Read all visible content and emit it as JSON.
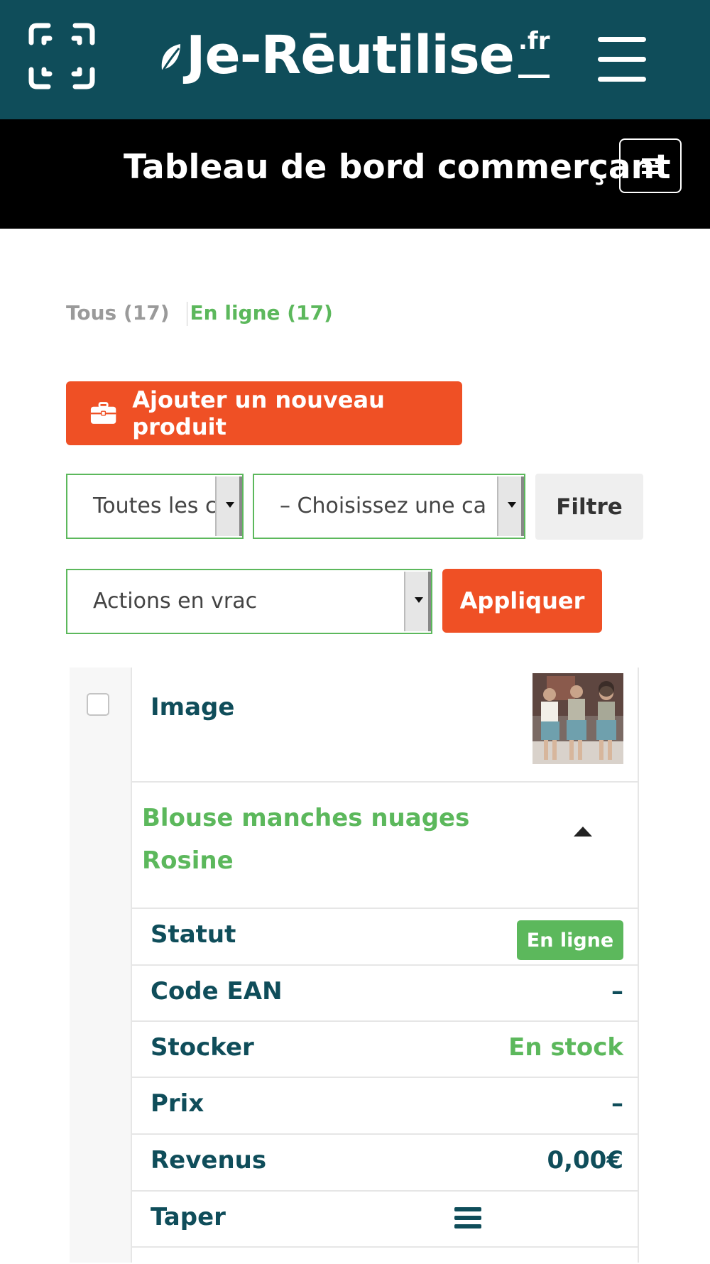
{
  "header": {
    "scan_icon": "qr-scan-icon",
    "brand_main": "Je-Rēutilise",
    "brand_tld": ".fr",
    "menu_icon": "hamburger-icon"
  },
  "dashboard": {
    "title": "Tableau de bord commerçant",
    "menu_icon": "menu-icon"
  },
  "status_filters": {
    "all": "Tous (17)",
    "online": "En ligne (17)"
  },
  "actions": {
    "add_product": "Ajouter un nouveau produit",
    "add_product_icon": "briefcase-icon",
    "filter_type_value": "Toutes les c",
    "filter_category_value": "– Choisissez une ca",
    "filter_button": "Filtre",
    "bulk_actions_value": "Actions en vrac",
    "apply_button": "Appliquer"
  },
  "product": {
    "image_label": "Image",
    "name": "Blouse manches nuages Rosine",
    "rows": [
      {
        "label": "Statut",
        "value": "En ligne"
      },
      {
        "label": "Code EAN",
        "value": "–"
      },
      {
        "label": "Stocker",
        "value": "En stock"
      },
      {
        "label": "Prix",
        "value": "–"
      },
      {
        "label": "Revenus",
        "value": "0,00€"
      },
      {
        "label": "Taper",
        "value": ""
      }
    ]
  },
  "colors": {
    "brand_teal": "#0f4d5a",
    "accent_orange": "#ef5025",
    "status_green": "#5cb85c"
  }
}
